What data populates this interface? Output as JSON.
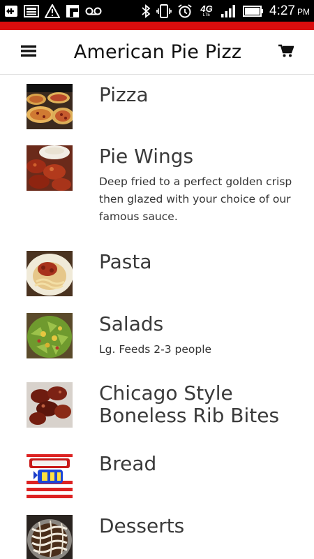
{
  "status_bar": {
    "time": "4:27",
    "ampm": "PM",
    "left_icons": [
      "add-box-icon",
      "image-icon",
      "warning-icon",
      "flipboard-icon",
      "voicemail-icon"
    ],
    "right_icons": [
      "bluetooth-icon",
      "vibrate-icon",
      "alarm-icon",
      "4g-lte-icon",
      "signal-icon",
      "battery-icon"
    ],
    "network_label": "4G",
    "network_sub": "LTE"
  },
  "header": {
    "title": "American Pie Pizz",
    "menu_icon": "hamburger-menu-icon",
    "cart_icon": "shopping-cart-icon"
  },
  "colors": {
    "accent": "#d90d0d",
    "status_bar_bg": "#000000",
    "text": "#333333"
  },
  "menu": {
    "items": [
      {
        "title": "Pizza",
        "description": "",
        "thumbnail": "pizza-photo"
      },
      {
        "title": "Pie Wings",
        "description": "Deep fried to a perfect golden crisp then glazed with your choice of our famous sauce.",
        "thumbnail": "wings-photo"
      },
      {
        "title": "Pasta",
        "description": "",
        "thumbnail": "pasta-photo"
      },
      {
        "title": "Salads",
        "description": "Lg. Feeds 2-3 people",
        "thumbnail": "salad-photo"
      },
      {
        "title": "Chicago Style Boneless Rib Bites",
        "description": "",
        "thumbnail": "rib-bites-photo"
      },
      {
        "title": "Bread",
        "description": "",
        "thumbnail": "bread-logo"
      },
      {
        "title": "Desserts",
        "description": "",
        "thumbnail": "dessert-photo"
      }
    ]
  }
}
